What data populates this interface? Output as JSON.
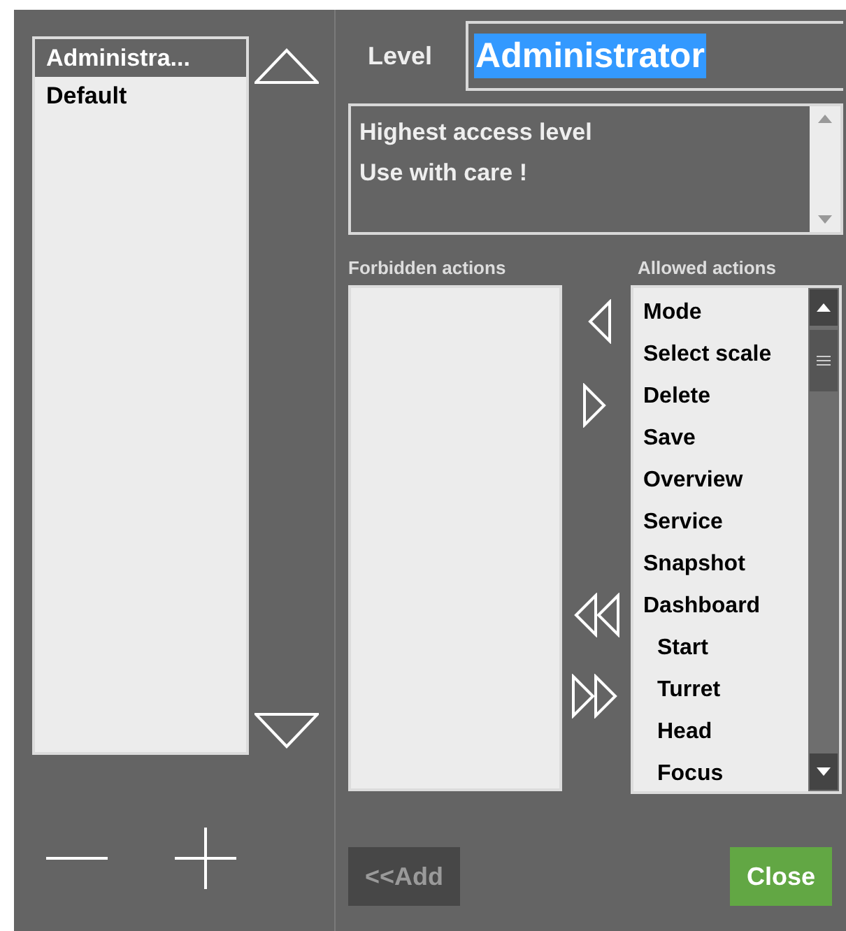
{
  "levels": {
    "items": [
      {
        "label": "Administra...",
        "selected": true
      },
      {
        "label": "Default",
        "selected": false
      }
    ]
  },
  "level_field": {
    "label": "Level",
    "value": "Administrator",
    "text_selected": true
  },
  "description": {
    "lines": [
      "Highest access level",
      "Use with care !"
    ]
  },
  "forbidden": {
    "title": "Forbidden actions"
  },
  "allowed": {
    "title": "Allowed actions",
    "items": [
      {
        "label": "Mode"
      },
      {
        "label": "Select scale"
      },
      {
        "label": "Delete"
      },
      {
        "label": "Save"
      },
      {
        "label": "Overview"
      },
      {
        "label": "Service"
      },
      {
        "label": "Snapshot"
      },
      {
        "label": "Dashboard",
        "children": [
          {
            "label": "Start"
          },
          {
            "label": "Turret"
          },
          {
            "label": "Head"
          },
          {
            "label": "Focus"
          }
        ]
      }
    ]
  },
  "buttons": [
    {
      "kind": "add",
      "label": "<<Add",
      "disabled": true
    },
    {
      "kind": "close",
      "label": "Close",
      "disabled": false
    }
  ]
}
